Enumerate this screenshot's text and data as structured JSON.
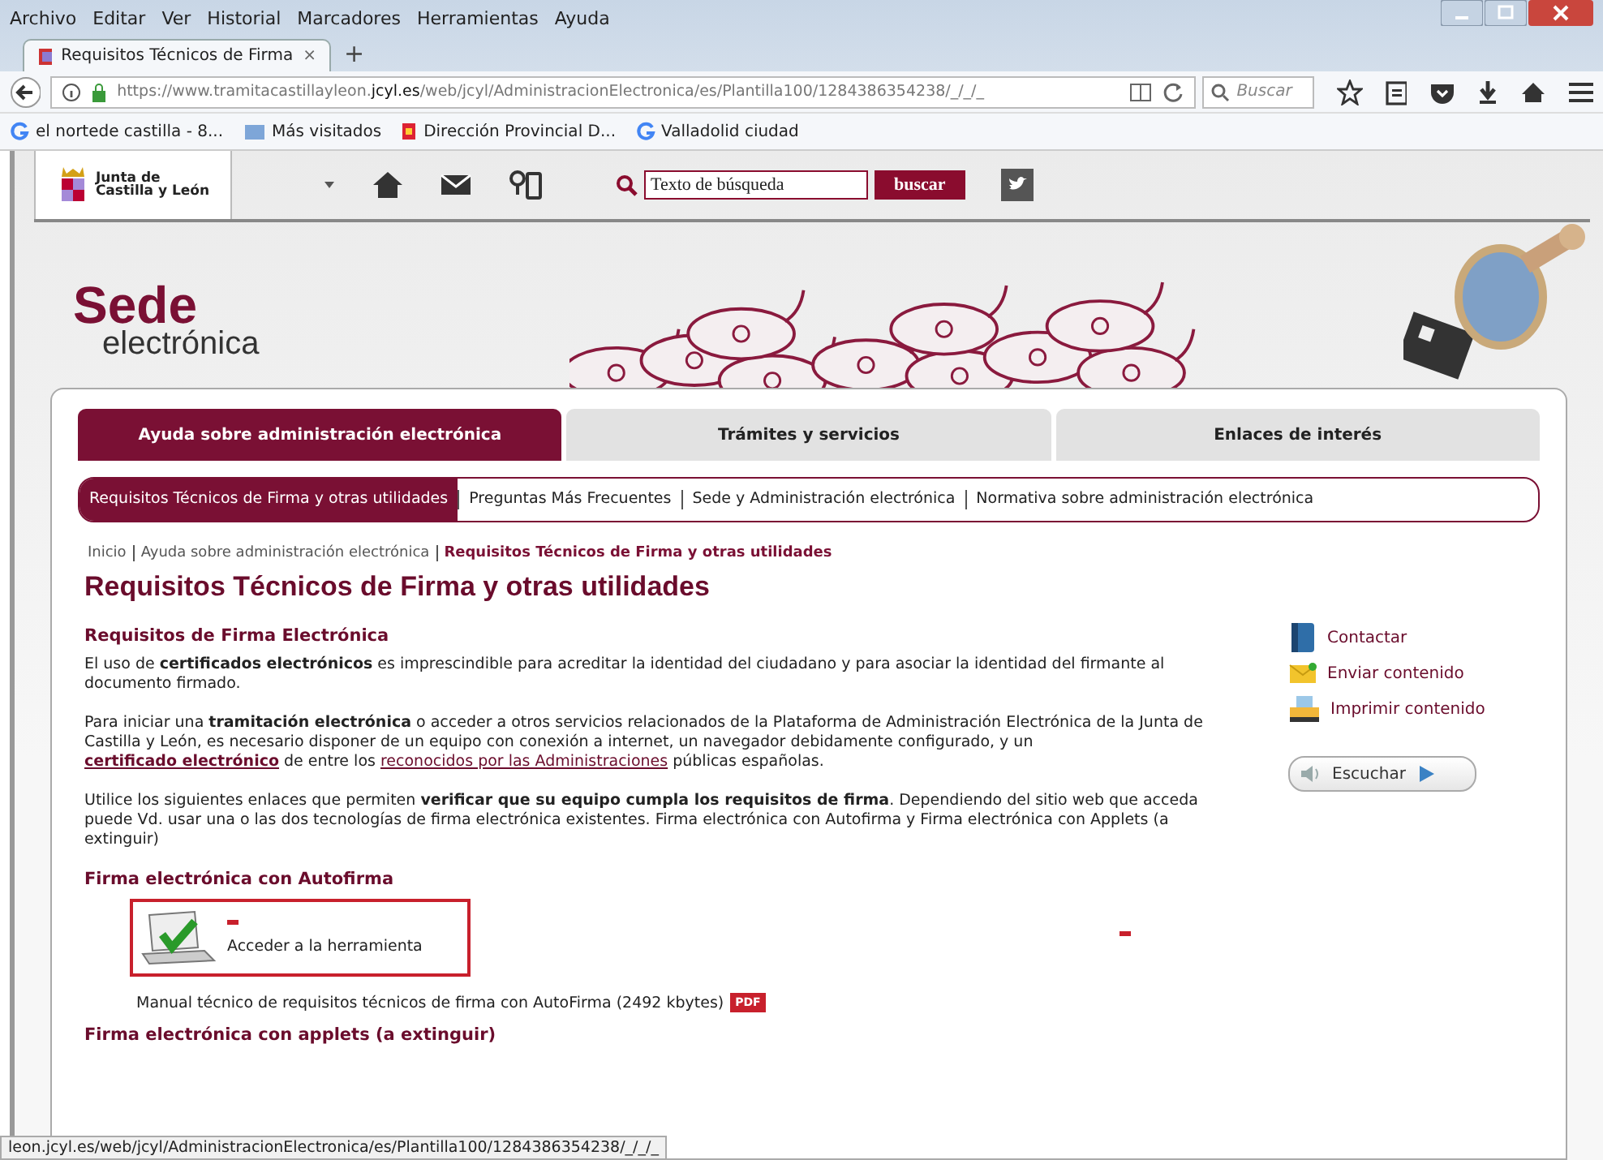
{
  "menu_bar": [
    "Archivo",
    "Editar",
    "Ver",
    "Historial",
    "Marcadores",
    "Herramientas",
    "Ayuda"
  ],
  "tabs": [
    {
      "label": "Requisitos Técnicos de Firma",
      "close": "×",
      "selected": true
    }
  ],
  "new_tab": "+",
  "address_bar": {
    "url_start": "https://www.tramitacastillayleon.",
    "url_domain": "jcyl.es",
    "url_end": "/web/jcyl/AdministracionElectronica/es/Plantilla100/1284386354238/_/_/_",
    "search_placeholder": "Buscar"
  },
  "bookmarks": [
    {
      "label": "el nortede castilla - 8...",
      "kind": "google"
    },
    {
      "label": "Más visitados",
      "kind": "folder"
    },
    {
      "label": "Dirección Provincial D...",
      "kind": "site"
    },
    {
      "label": "Valladolid ciudad",
      "kind": "google"
    }
  ],
  "site_header": {
    "logo_line_1": "Junta de",
    "logo_line_2": "Castilla y León",
    "search_placeholder": "Texto de búsqueda",
    "search_button": "buscar"
  },
  "banner": {
    "title": "Sede",
    "subtitle": "electrónica"
  },
  "main_tabs": [
    {
      "label": "Ayuda sobre administración electrónica",
      "selected": true
    },
    {
      "label": "Trámites y servicios",
      "selected": false
    },
    {
      "label": "Enlaces de interés",
      "selected": false
    }
  ],
  "sub_nav": [
    {
      "label": "Requisitos Técnicos de Firma y otras utilidades",
      "selected": true
    },
    {
      "label": "Preguntas Más Frecuentes",
      "selected": false
    },
    {
      "label": "Sede y Administración electrónica",
      "selected": false
    },
    {
      "label": "Normativa sobre administración electrónica",
      "selected": false
    }
  ],
  "breadcrumb": [
    {
      "label": "Inicio",
      "current": false
    },
    {
      "label": "Ayuda sobre administración electrónica",
      "current": false
    },
    {
      "label": "Requisitos Técnicos de Firma y otras utilidades",
      "current": true
    }
  ],
  "page_title": "Requisitos Técnicos de Firma y otras utilidades",
  "section_heading": "Requisitos de Firma Electrónica",
  "paragraphs": [
    [
      {
        "kind": "text",
        "text": "El uso de "
      },
      {
        "kind": "bold",
        "text": "certificados electrónicos"
      },
      {
        "kind": "text",
        "text": " es imprescindible para acreditar la identidad del ciudadano y para asociar la identidad del firmante al documento firmado."
      }
    ],
    [
      {
        "kind": "text",
        "text": "Para iniciar una "
      },
      {
        "kind": "bold",
        "text": "tramitación electrónica"
      },
      {
        "kind": "text",
        "text": " o acceder a otros servicios relacionados de la Plataforma de Administración Electrónica de la Junta de Castilla y León, es necesario disponer de un equipo con conexión a internet, un navegador debidamente configurado, y un "
      },
      {
        "kind": "strong_link",
        "text": "certificado electrónico"
      },
      {
        "kind": "text",
        "text": "  de entre los "
      },
      {
        "kind": "link",
        "text": "reconocidos por las Administraciones"
      },
      {
        "kind": "text",
        "text": "  públicas españolas."
      }
    ],
    [
      {
        "kind": "text",
        "text": "Utilice los siguientes enlaces que permiten "
      },
      {
        "kind": "bold",
        "text": "verificar que su equipo cumpla los requisitos de firma"
      },
      {
        "kind": "text",
        "text": ". Dependiendo del sitio web que acceda puede Vd. usar una o las dos tecnologías de firma electrónica existentes. Firma electrónica con Autofirma y Firma electrónica con Applets (a extinguir)"
      }
    ]
  ],
  "autofirma": {
    "heading": "Firma electrónica con Autofirma",
    "tool_link": "Acceder a la herramienta",
    "manual_link": "Manual técnico de requisitos técnicos de firma con AutoFirma (2492 kbytes)",
    "manual_badge": "PDF"
  },
  "applets_heading": "Firma electrónica con applets (a extinguir)",
  "side_actions": [
    {
      "label": "Contactar",
      "kind": "contact"
    },
    {
      "label": "Enviar contenido",
      "kind": "mail"
    },
    {
      "label": "Imprimir contenido",
      "kind": "print"
    }
  ],
  "listen_button": "Escuchar",
  "status_bar": "leon.jcyl.es/web/jcyl/AdministracionElectronica/es/Plantilla100/1284386354238/_/_/_"
}
